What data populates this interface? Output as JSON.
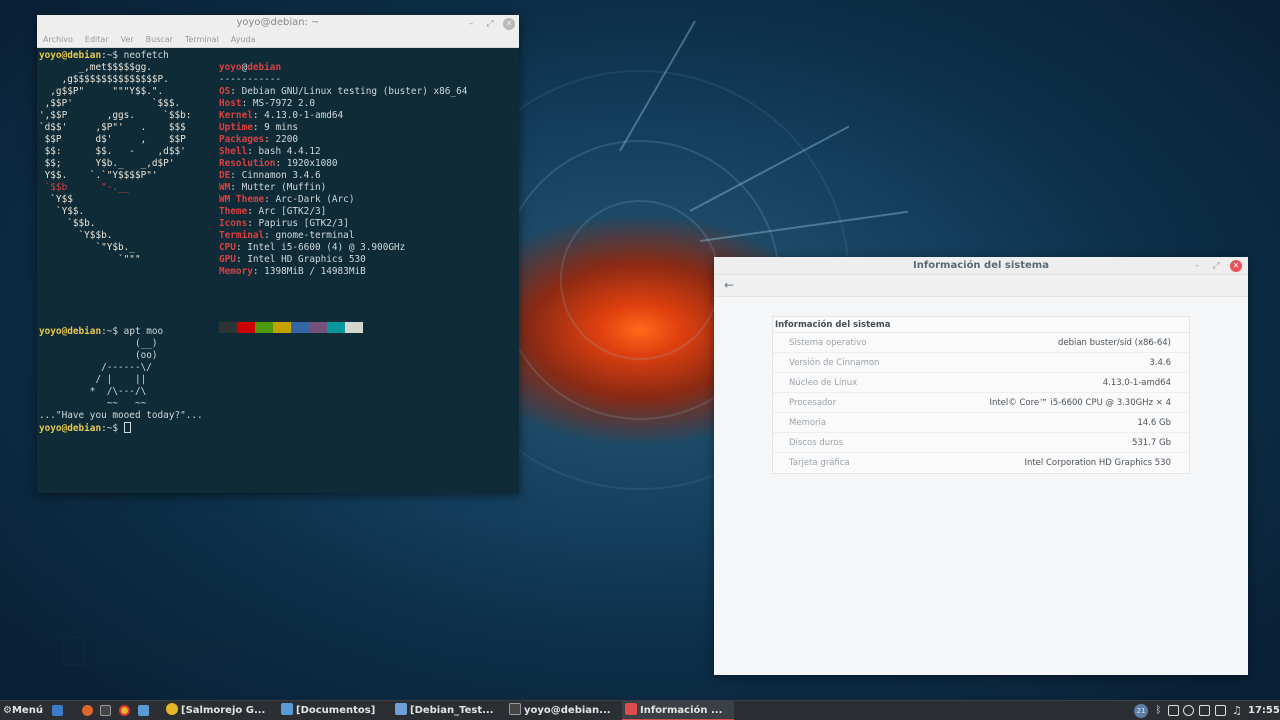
{
  "terminal": {
    "title": "yoyo@debian: ~",
    "menu": [
      "Archivo",
      "Editar",
      "Ver",
      "Buscar",
      "Terminal",
      "Ayuda"
    ],
    "prompt_user": "yoyo",
    "prompt_host": "@debian",
    "prompt_path": ":~$ ",
    "cmd1": "neofetch",
    "cmd2": "apt moo",
    "art": [
      "       _,met$$$$$gg.",
      "    ,g$$$$$$$$$$$$$$$P.",
      "  ,g$$P\"     \"\"\"Y$$.\".",
      " ,$$P'              `$$$.",
      "',$$P       ,ggs.     `$$b:",
      "`d$$'     ,$P\"'   .    $$$",
      " $$P      d$'     ,    $$P",
      " $$:      $$.   -    ,d$$'",
      " $$;      Y$b._   _,d$P'",
      " Y$$.    `.`\"Y$$$$P\"'",
      " `$$b      \"-.__",
      "  `Y$$",
      "   `Y$$.",
      "     `$$b.",
      "       `Y$$b.",
      "          `\"Y$b._",
      "              `\"\"\""
    ],
    "info_user": "yoyo",
    "info_at": "@",
    "info_host": "debian",
    "info_sep": "-----------",
    "info": [
      {
        "key": "OS",
        "value": "Debian GNU/Linux testing (buster) x86_64"
      },
      {
        "key": "Host",
        "value": "MS-7972 2.0"
      },
      {
        "key": "Kernel",
        "value": "4.13.0-1-amd64"
      },
      {
        "key": "Uptime",
        "value": "9 mins"
      },
      {
        "key": "Packages",
        "value": "2200"
      },
      {
        "key": "Shell",
        "value": "bash 4.4.12"
      },
      {
        "key": "Resolution",
        "value": "1920x1080"
      },
      {
        "key": "DE",
        "value": "Cinnamon 3.4.6"
      },
      {
        "key": "WM",
        "value": "Mutter (Muffin)"
      },
      {
        "key": "WM Theme",
        "value": "Arc-Dark (Arc)"
      },
      {
        "key": "Theme",
        "value": "Arc [GTK2/3]"
      },
      {
        "key": "Icons",
        "value": "Papirus [GTK2/3]"
      },
      {
        "key": "Terminal",
        "value": "gnome-terminal"
      },
      {
        "key": "CPU",
        "value": "Intel i5-6600 (4) @ 3.900GHz"
      },
      {
        "key": "GPU",
        "value": "Intel HD Graphics 530"
      },
      {
        "key": "Memory",
        "value": "1398MiB / 14983MiB"
      }
    ],
    "palette": [
      "#2e3436",
      "#cc0000",
      "#4e9a06",
      "#c4a000",
      "#3465a4",
      "#75507b",
      "#06989a",
      "#d3d7cf"
    ],
    "cow": [
      "                 (__)",
      "                 (oo)",
      "           /------\\/",
      "          / |    ||",
      "         *  /\\---/\\",
      "            ~~   ~~",
      "...\"Have you mooed today?\"..."
    ]
  },
  "sysinfo": {
    "title": "Información del sistema",
    "heading": "Información del sistema",
    "rows": [
      {
        "label": "Sistema operativo",
        "value": "debian buster/sid (x86-64)"
      },
      {
        "label": "Versión de Cinnamon",
        "value": "3.4.6"
      },
      {
        "label": "Núcleo de Linux",
        "value": "4.13.0-1-amd64"
      },
      {
        "label": "Procesador",
        "value": "Intel© Core™ i5-6600 CPU @ 3.30GHz × 4"
      },
      {
        "label": "Memoria",
        "value": "14.6 Gb"
      },
      {
        "label": "Discos duros",
        "value": "531.7 Gb"
      },
      {
        "label": "Tarjeta gráfica",
        "value": "Intel Corporation HD Graphics 530"
      }
    ]
  },
  "taskbar": {
    "menu_label": "Menú",
    "tasks": [
      "[Salmorejo G...",
      "[Documentos]",
      "[Debian_Test...",
      "yoyo@debian...",
      "Información ..."
    ],
    "clock": "17:55",
    "tray_badge": "21",
    "colors": {
      "active_underline": "#d94d4d",
      "close_red": "#e9525a",
      "prompt_yellow": "#e8c84a",
      "key_red": "#d94040"
    }
  }
}
